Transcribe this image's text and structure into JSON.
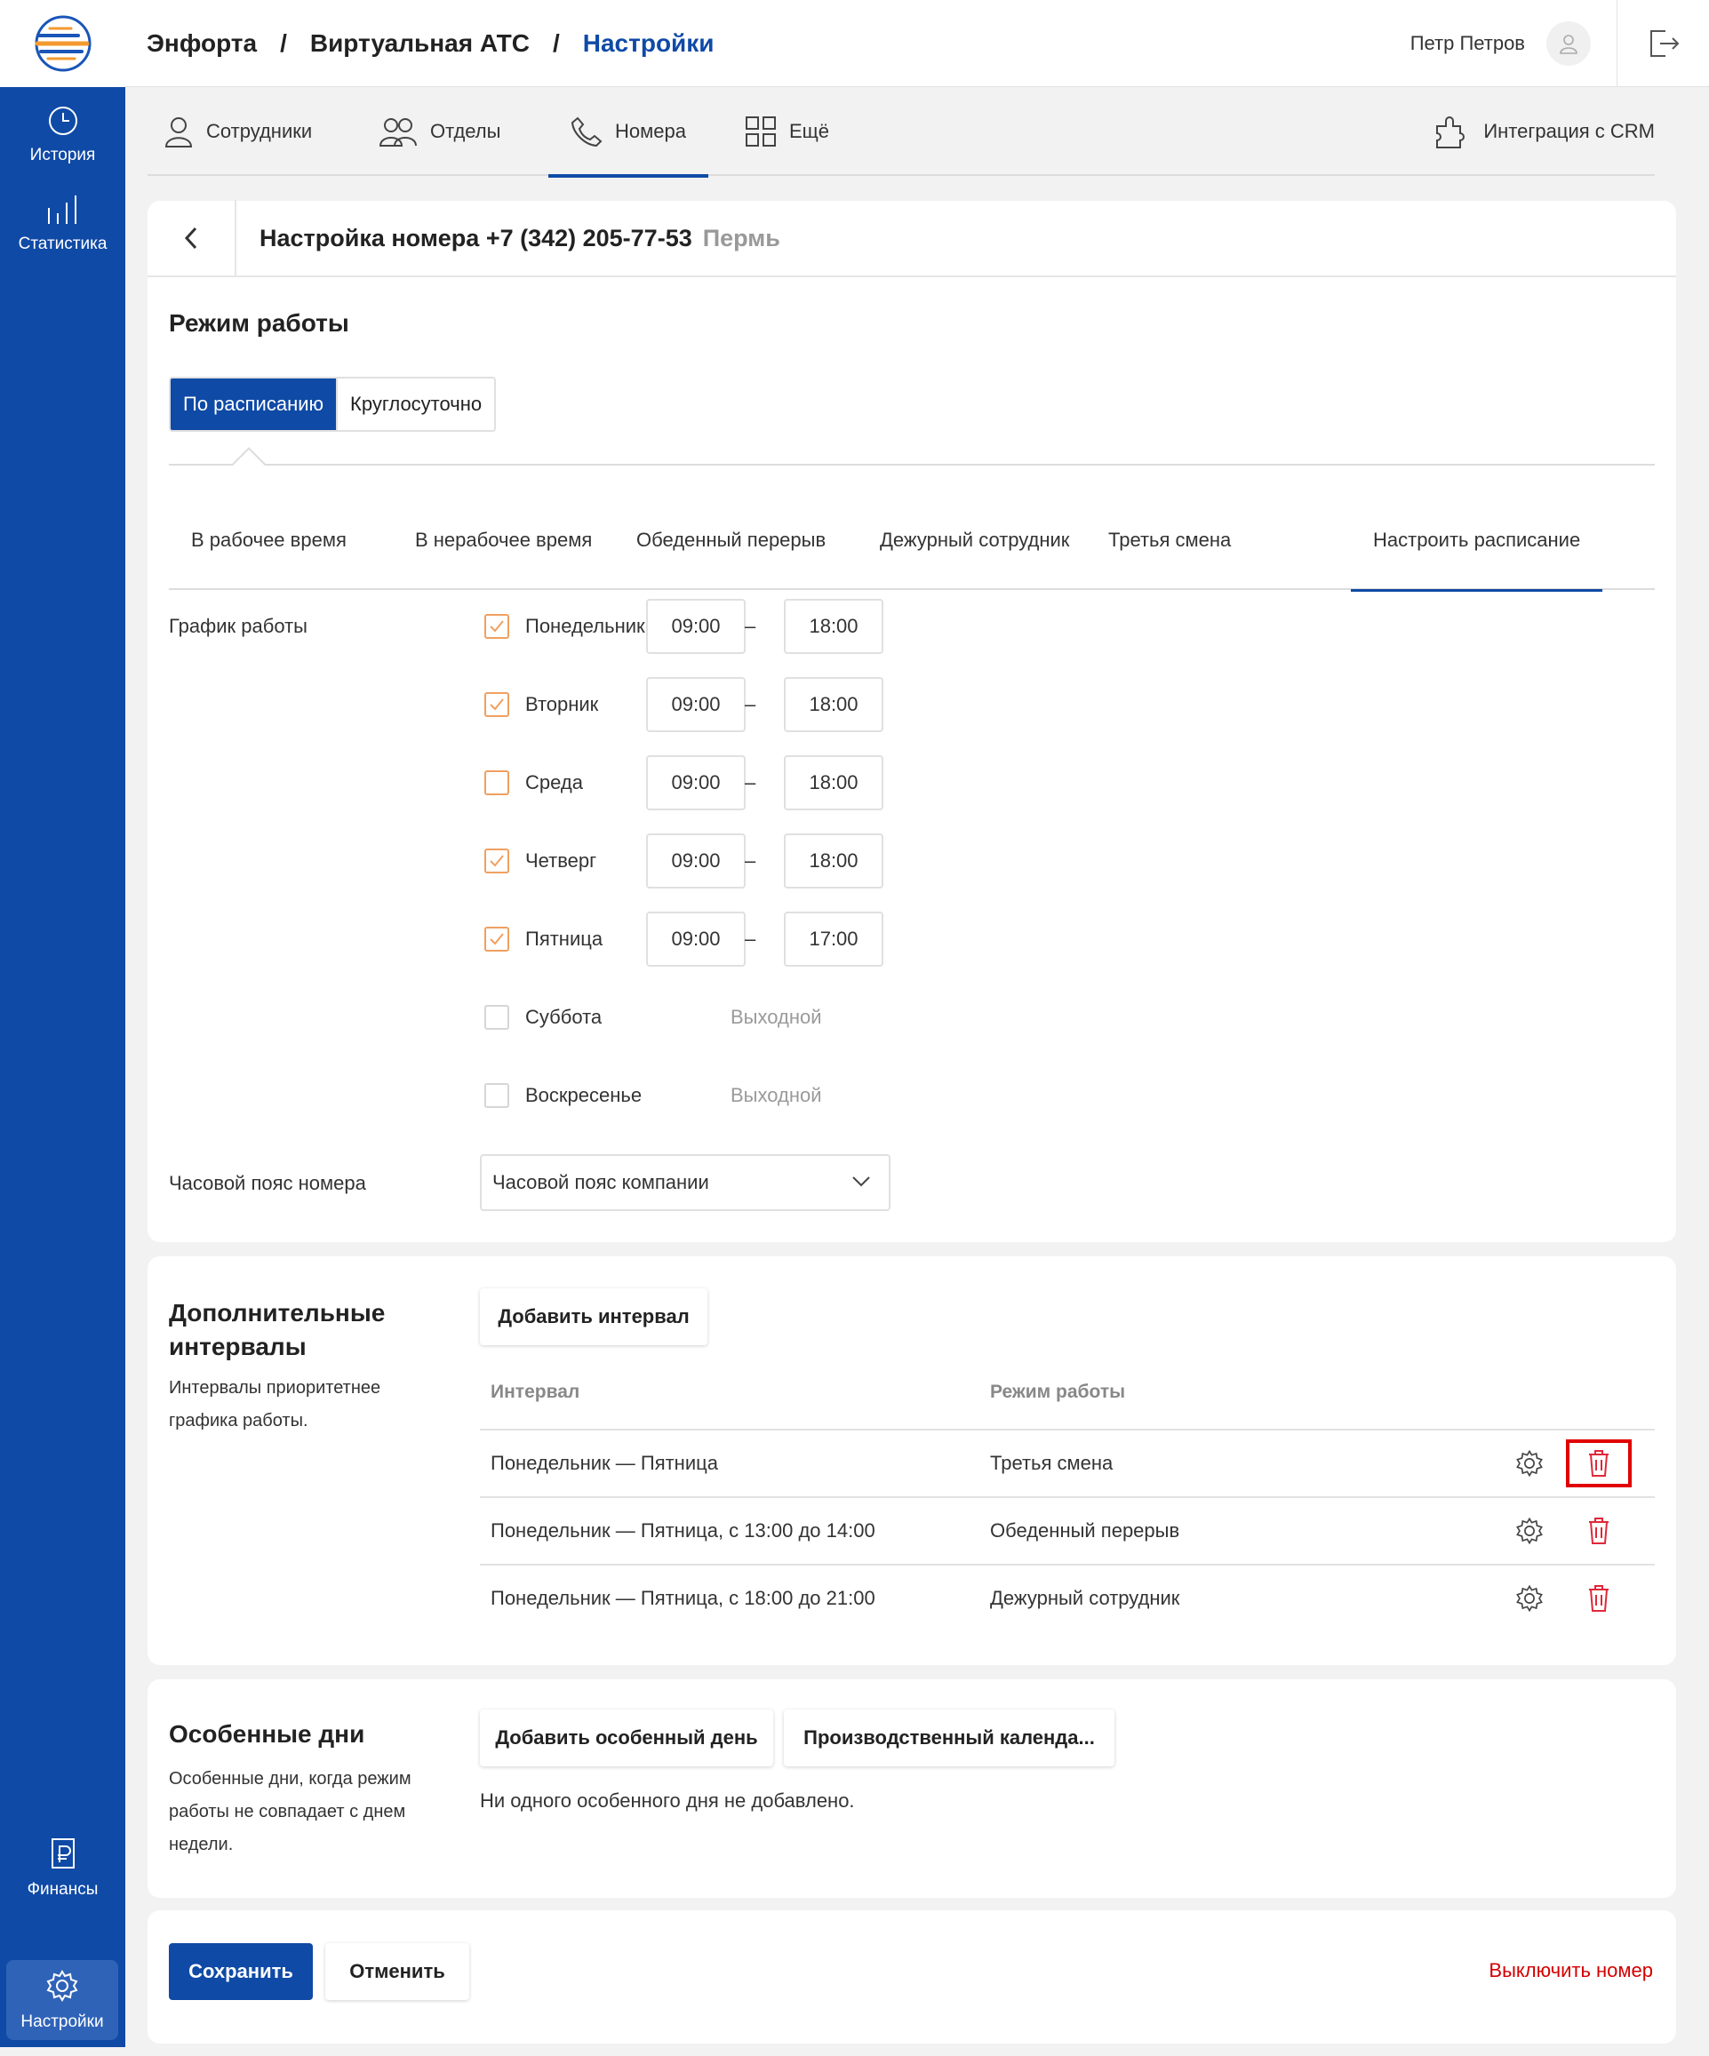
{
  "breadcrumb": [
    "Энфорта",
    "Виртуальная АТС",
    "Настройки"
  ],
  "user": {
    "name": "Петр Петров"
  },
  "sidebar": {
    "top_items": [
      {
        "label": "История",
        "icon": "clock-icon"
      },
      {
        "label": "Статистика",
        "icon": "stats-icon"
      }
    ],
    "bottom_items": [
      {
        "label": "Финансы",
        "icon": "ruble-doc-icon"
      },
      {
        "label": "Настройки",
        "icon": "gear-icon"
      }
    ]
  },
  "nav": {
    "tabs": [
      {
        "label": "Сотрудники",
        "icon": "user-icon"
      },
      {
        "label": "Отделы",
        "icon": "users-icon"
      },
      {
        "label": "Номера",
        "icon": "phone-icon"
      },
      {
        "label": "Ещё",
        "icon": "grid-icon"
      }
    ],
    "active": "Номера",
    "crm": "Интеграция с CRM"
  },
  "number_settings": {
    "title": "Настройка номера +7 (342) 205-77-53",
    "city": "Пермь"
  },
  "work_mode": {
    "title": "Режим работы",
    "modes": [
      "По расписанию",
      "Круглосуточно"
    ],
    "active_mode": "По расписанию",
    "subtabs": [
      "В рабочее время",
      "В нерабочее время",
      "Обеденный перерыв",
      "Дежурный сотрудник",
      "Третья смена",
      "Настроить расписание"
    ],
    "active_subtab": "Настроить расписание"
  },
  "schedule": {
    "label": "График работы",
    "days": [
      {
        "name": "Понедельник",
        "checked": true,
        "from": "09:00",
        "to": "18:00"
      },
      {
        "name": "Вторник",
        "checked": true,
        "from": "09:00",
        "to": "18:00"
      },
      {
        "name": "Среда",
        "checked": false,
        "from": "09:00",
        "to": "18:00"
      },
      {
        "name": "Четверг",
        "checked": true,
        "from": "09:00",
        "to": "18:00"
      },
      {
        "name": "Пятница",
        "checked": true,
        "from": "09:00",
        "to": "17:00"
      },
      {
        "name": "Суббота",
        "checked": false,
        "off_text": "Выходной"
      },
      {
        "name": "Воскресенье",
        "checked": false,
        "off_text": "Выходной"
      }
    ],
    "separator": "–",
    "timezone_label": "Часовой пояс номера",
    "timezone_value": "Часовой пояс компании"
  },
  "intervals": {
    "title_line1": "Дополнительные",
    "title_line2": "интервалы",
    "desc_line1": "Интервалы приоритетнее",
    "desc_line2": "графика работы.",
    "add_button": "Добавить интервал",
    "columns": [
      "Интервал",
      "Режим работы"
    ],
    "rows": [
      {
        "interval": "Понедельник — Пятница",
        "mode": "Третья смена"
      },
      {
        "interval": "Понедельник — Пятница, с 13:00 до 14:00",
        "mode": "Обеденный перерыв"
      },
      {
        "interval": "Понедельник — Пятница, с 18:00 до 21:00",
        "mode": "Дежурный сотрудник"
      }
    ]
  },
  "special_days": {
    "title": "Особенные дни",
    "desc_line1": "Особенные дни, когда режим",
    "desc_line2": "работы не совпадает с днем",
    "desc_line3": "недели.",
    "add_button": "Добавить особенный день",
    "calendar_button": "Производственный календа...",
    "empty_text": "Ни одного особенного дня не добавлено."
  },
  "footer": {
    "save": "Сохранить",
    "cancel": "Отменить",
    "disable": "Выключить номер"
  },
  "colors": {
    "brand": "#0f4aa6",
    "accent_orange": "#f0a060",
    "danger": "#d40000"
  }
}
